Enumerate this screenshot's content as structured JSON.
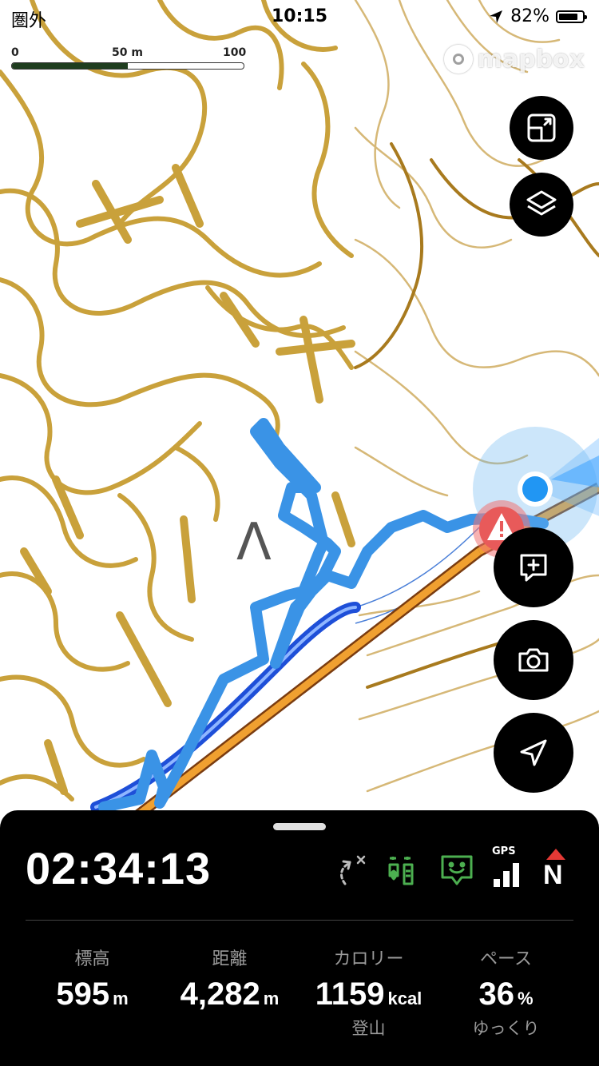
{
  "status_bar": {
    "carrier": "圏外",
    "time": "10:15",
    "battery_percent": "82%",
    "battery_level": 0.82
  },
  "scale_bar": {
    "labels": [
      "0",
      "50 m",
      "100 m"
    ]
  },
  "map": {
    "attribution": "mapbox",
    "summit_symbol": "Λ",
    "colors": {
      "contour": "#c9a13b",
      "contour_thin": "#d6b877",
      "track": "#3a93e6",
      "road": "#f0a030",
      "location": "#2196f3"
    }
  },
  "map_controls": [
    {
      "id": "fit-bounds",
      "icon": "fit-bounds-icon"
    },
    {
      "id": "layers",
      "icon": "layers-icon"
    },
    {
      "id": "add-note",
      "icon": "add-note-icon"
    },
    {
      "id": "camera",
      "icon": "camera-icon"
    },
    {
      "id": "locate",
      "icon": "location-arrow-icon"
    }
  ],
  "sheet": {
    "elapsed_time": "02:34:13",
    "status_icons": {
      "gps_label": "GPS",
      "compass_label": "N"
    },
    "stats": [
      {
        "label": "標高",
        "value": "595",
        "unit": "m",
        "sub": ""
      },
      {
        "label": "距離",
        "value": "4,282",
        "unit": "m",
        "sub": ""
      },
      {
        "label": "カロリー",
        "value": "1159",
        "unit": "kcal",
        "sub": "登山"
      },
      {
        "label": "ペース",
        "value": "36",
        "unit": "%",
        "sub": "ゆっくり"
      }
    ]
  }
}
